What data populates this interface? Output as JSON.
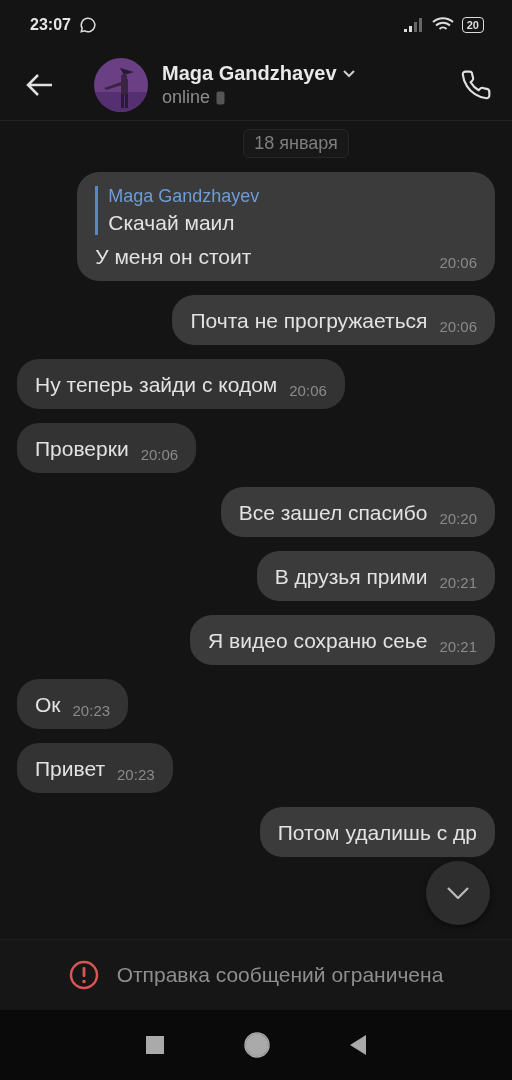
{
  "status_bar": {
    "time": "23:07",
    "battery": "20"
  },
  "header": {
    "name": "Maga Gandzhayev",
    "status": "online"
  },
  "date_chip": "18 января",
  "messages": [
    {
      "outgoing": true,
      "quote": {
        "author": "Maga Gandzhayev",
        "text": "Скачай маил"
      },
      "text": "У меня он стоит",
      "time": "20:06"
    },
    {
      "outgoing": true,
      "text": "Почта не прогружаеться",
      "time": "20:06"
    },
    {
      "outgoing": false,
      "text": "Ну теперь зайди с кодом",
      "time": "20:06"
    },
    {
      "outgoing": false,
      "text": "Проверки",
      "time": "20:06"
    },
    {
      "outgoing": true,
      "text": "Все зашел спасибо",
      "time": "20:20"
    },
    {
      "outgoing": true,
      "text": "В друзья прими",
      "time": "20:21"
    },
    {
      "outgoing": true,
      "text": "Я видео сохраню сеье",
      "time": "20:21"
    },
    {
      "outgoing": false,
      "text": "Ок",
      "time": "20:23"
    },
    {
      "outgoing": false,
      "text": "Привет",
      "time": "20:23"
    },
    {
      "outgoing": true,
      "text": "Потом удалишь с др"
    }
  ],
  "banner": {
    "text": "Отправка сообщений ограничена"
  }
}
